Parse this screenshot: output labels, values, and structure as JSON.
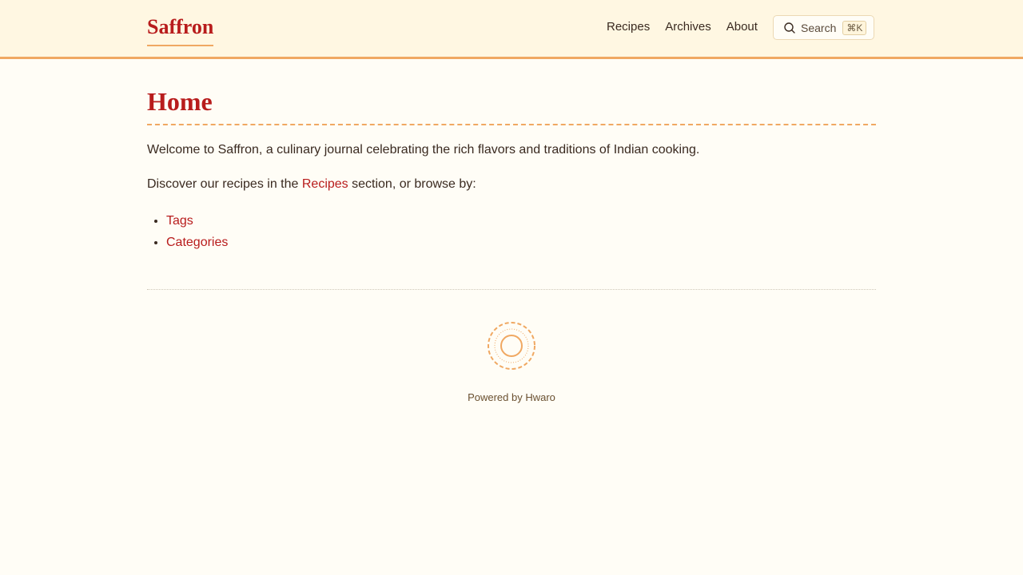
{
  "header": {
    "site_title": "Saffron",
    "nav": [
      "Recipes",
      "Archives",
      "About"
    ],
    "search_label": "Search",
    "search_shortcut": "⌘K"
  },
  "main": {
    "title": "Home",
    "intro": "Welcome to Saffron, a culinary journal celebrating the rich flavors and traditions of Indian cooking.",
    "discover_prefix": "Discover our recipes in the ",
    "discover_link": "Recipes",
    "discover_suffix": " section, or browse by:",
    "browse_links": [
      "Tags",
      "Categories"
    ]
  },
  "footer": {
    "powered_by": "Powered by Hwaro",
    "logo_icon": "saffron-circle-icon"
  },
  "colors": {
    "accent": "#b81c1c",
    "border": "#f0a862",
    "header_bg": "#fff7e2",
    "page_bg": "#fffdf6"
  }
}
